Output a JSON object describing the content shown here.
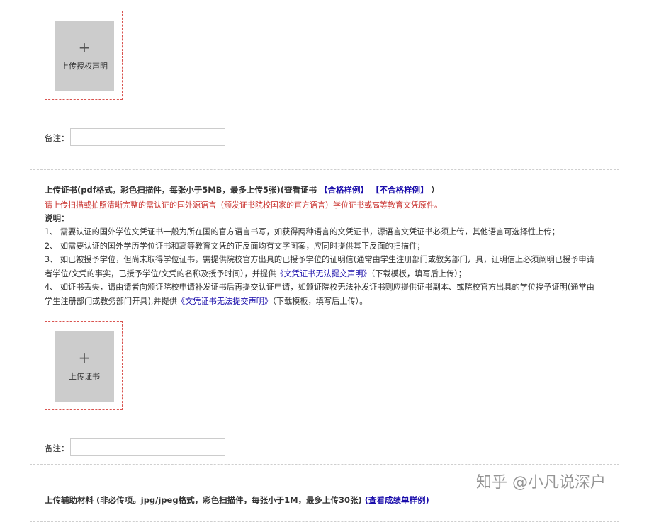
{
  "auth_section": {
    "upload_label": "上传授权声明",
    "plus": "+",
    "remark_label": "备注：",
    "remark_value": ""
  },
  "cert_section": {
    "title_prefix": "上传证书(pdf格式，彩色扫描件，每张小于5MB，最多上传5张)(查看证书",
    "qualified_link": "【合格样例】",
    "unqualified_link": "【不合格样例】",
    "title_suffix": "）",
    "red_note": "请上传扫描或拍照清晰完整的需认证的国外源语言（颁发证书院校国家的官方语言）学位证书或高等教育文凭原件。",
    "notes_heading": "说明：",
    "note1": "1、 需要认证的国外学位文凭证书一般为所在国的官方语言书写，如获得两种语言的文凭证书，源语言文凭证书必须上传，其他语言可选择性上传；",
    "note2": "2、 如需要认证的国外学历学位证书和高等教育文凭的正反面均有文字图案，应同时提供其正反面的扫描件；",
    "note3_a": "3、 如已被授予学位，但尚未取得学位证书，需提供院校官方出具的已授予学位的证明信(通常由学生注册部门或教务部门开具，证明信上必须阐明已授予申请者学位/文凭的事实，已授予学位/文凭的名称及授予时间），并提供",
    "note3_link": "《文凭证书无法提交声明》",
    "note3_b": "（下载模板，填写后上传）；",
    "note4_a": "4、 如证书丢失，请由请者向颁证院校申请补发证书后再提交认证申请，如颁证院校无法补发证书则应提供证书副本、或院校官方出具的学位授予证明(通常由学生注册部门或教务部门开具),并提供",
    "note4_link": "《文凭证书无法提交声明》",
    "note4_b": "（下载模板，填写后上传）。",
    "upload_label": "上传证书",
    "plus": "+",
    "remark_label": "备注：",
    "remark_value": ""
  },
  "aux_section": {
    "title_prefix": "上传辅助材料 (非必传项。jpg/jpeg格式，彩色扫描件，每张小于1M，最多上传30张)",
    "sample_link": "(查看成绩单样例)"
  },
  "watermark": "知乎 @小凡说深户"
}
